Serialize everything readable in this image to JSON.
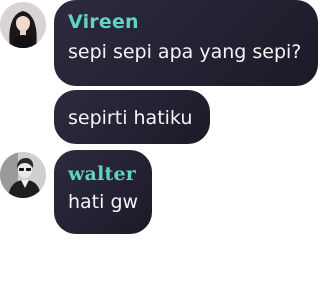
{
  "messages": [
    {
      "sender": "Vireen",
      "avatar": "woman-portrait-avatar",
      "texts": [
        "sepi sepi apa yang sepi?",
        "sepirti hatiku"
      ]
    },
    {
      "sender": "walter",
      "avatar": "man-portrait-avatar",
      "texts": [
        "hati gw"
      ]
    }
  ],
  "colors": {
    "bubble": "#2e2a3f",
    "sender_name": "#5fd4c6",
    "message_text": "#f4f4f6",
    "background": "#ffffff"
  }
}
